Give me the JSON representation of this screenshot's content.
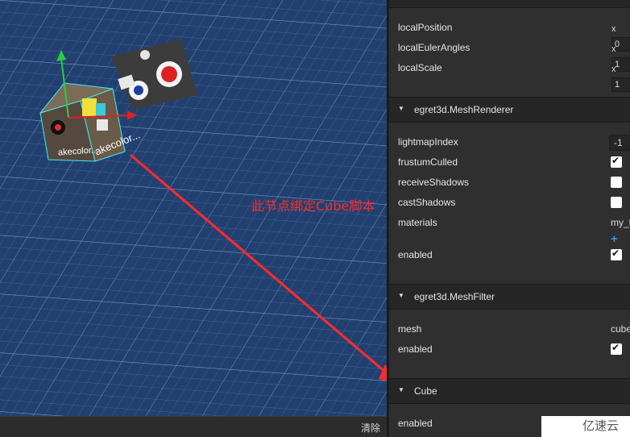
{
  "scene": {
    "cube_label": "akecolor..",
    "cube_label_side": "akecolor..."
  },
  "console": {
    "clear_label": "清除"
  },
  "inspector": {
    "transform": {
      "localPosition": {
        "label": "localPosition",
        "x_axis": "x",
        "x": "0"
      },
      "localEulerAngles": {
        "label": "localEulerAngles",
        "x_axis": "x",
        "x": "1"
      },
      "localScale": {
        "label": "localScale",
        "x_axis": "x",
        "x": "1"
      }
    },
    "mesh_renderer": {
      "title": "egret3d.MeshRenderer",
      "lightmapIndex": {
        "label": "lightmapIndex",
        "value": "-1"
      },
      "frustumCulled": {
        "label": "frustumCulled",
        "checked": true
      },
      "receiveShadows": {
        "label": "receiveShadows",
        "checked": false
      },
      "castShadows": {
        "label": "castShadows",
        "checked": false
      },
      "materials": {
        "label": "materials",
        "value": "my_t"
      },
      "enabled": {
        "label": "enabled",
        "checked": true
      }
    },
    "mesh_filter": {
      "title": "egret3d.MeshFilter",
      "mesh": {
        "label": "mesh",
        "value": "cube"
      },
      "enabled": {
        "label": "enabled",
        "checked": true
      }
    },
    "cube": {
      "title": "Cube",
      "enabled": {
        "label": "enabled"
      }
    }
  },
  "annotation": "此节点绑定Cube脚本",
  "watermark": "亿速云",
  "colors": {
    "annotation": "#ff2b2b",
    "scene_bg": "#22406f",
    "grid": "#5f86c2",
    "gizmo_y": "#2ecc40",
    "gizmo_x": "#e02020"
  }
}
